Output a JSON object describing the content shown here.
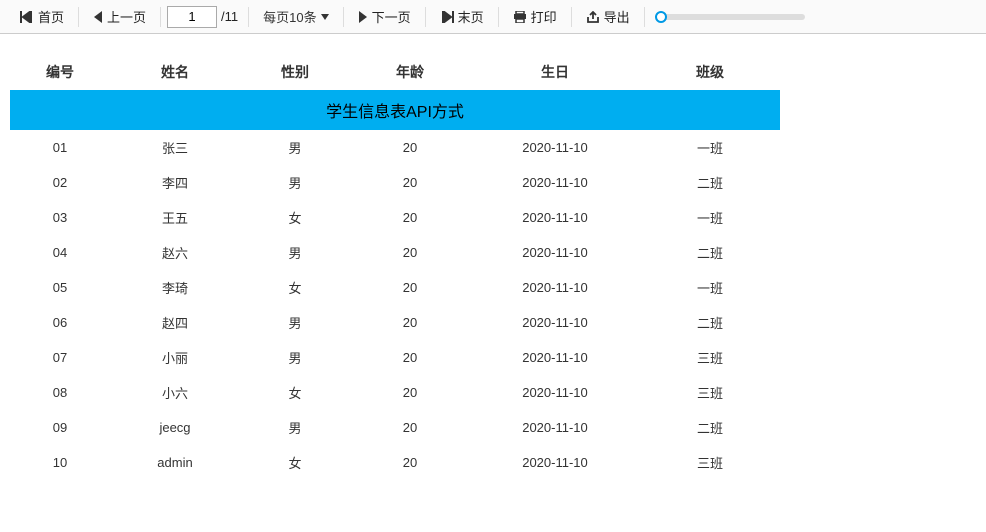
{
  "toolbar": {
    "first_label": "首页",
    "prev_label": "上一页",
    "page_value": "1",
    "page_total": "/11",
    "page_size_label": "每页10条",
    "next_label": "下一页",
    "last_label": "末页",
    "print_label": "打印",
    "export_label": "导出"
  },
  "table": {
    "title": "学生信息表API方式",
    "headers": {
      "id": "编号",
      "name": "姓名",
      "sex": "性别",
      "age": "年龄",
      "birthday": "生日",
      "class": "班级"
    },
    "rows": [
      {
        "id": "01",
        "name": "张三",
        "sex": "男",
        "age": "20",
        "birthday": "2020-11-10",
        "class": "一班"
      },
      {
        "id": "02",
        "name": "李四",
        "sex": "男",
        "age": "20",
        "birthday": "2020-11-10",
        "class": "二班"
      },
      {
        "id": "03",
        "name": "王五",
        "sex": "女",
        "age": "20",
        "birthday": "2020-11-10",
        "class": "一班"
      },
      {
        "id": "04",
        "name": "赵六",
        "sex": "男",
        "age": "20",
        "birthday": "2020-11-10",
        "class": "二班"
      },
      {
        "id": "05",
        "name": "李琦",
        "sex": "女",
        "age": "20",
        "birthday": "2020-11-10",
        "class": "一班"
      },
      {
        "id": "06",
        "name": "赵四",
        "sex": "男",
        "age": "20",
        "birthday": "2020-11-10",
        "class": "二班"
      },
      {
        "id": "07",
        "name": "小丽",
        "sex": "男",
        "age": "20",
        "birthday": "2020-11-10",
        "class": "三班"
      },
      {
        "id": "08",
        "name": "小六",
        "sex": "女",
        "age": "20",
        "birthday": "2020-11-10",
        "class": "三班"
      },
      {
        "id": "09",
        "name": "jeecg",
        "sex": "男",
        "age": "20",
        "birthday": "2020-11-10",
        "class": "二班"
      },
      {
        "id": "10",
        "name": "admin",
        "sex": "女",
        "age": "20",
        "birthday": "2020-11-10",
        "class": "三班"
      }
    ]
  }
}
